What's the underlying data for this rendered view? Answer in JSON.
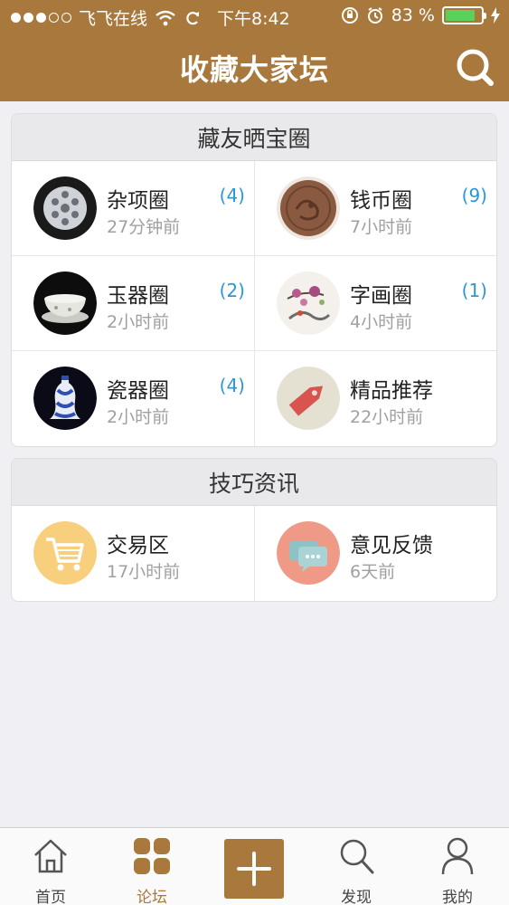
{
  "status_bar": {
    "carrier": "飞飞在线",
    "time": "下午8:42",
    "battery": "83 %",
    "battery_level": 0.83
  },
  "nav": {
    "title": "收藏大家坛"
  },
  "section_share": {
    "title": "藏友晒宝圈",
    "items": [
      {
        "name": "杂项圈",
        "time": "27分钟前",
        "count": "(4)",
        "icon": "misc-ware-icon"
      },
      {
        "name": "钱币圈",
        "time": "7小时前",
        "count": "(9)",
        "icon": "coin-icon"
      },
      {
        "name": "玉器圈",
        "time": "2小时前",
        "count": "(2)",
        "icon": "jade-bowl-icon"
      },
      {
        "name": "字画圈",
        "time": "4小时前",
        "count": "(1)",
        "icon": "painting-icon"
      },
      {
        "name": "瓷器圈",
        "time": "2小时前",
        "count": "(4)",
        "icon": "porcelain-vase-icon"
      },
      {
        "name": "精品推荐",
        "time": "22小时前",
        "count": "",
        "icon": "price-tag-icon"
      }
    ]
  },
  "section_tips": {
    "title": "技巧资讯",
    "items": [
      {
        "name": "交易区",
        "time": "17小时前",
        "icon": "shopping-cart-icon",
        "color": "#f7cf7d"
      },
      {
        "name": "意见反馈",
        "time": "6天前",
        "icon": "chat-bubbles-icon",
        "color": "#ee9a86"
      }
    ]
  },
  "tabbar": {
    "home": "首页",
    "forum": "论坛",
    "discover": "发现",
    "mine": "我的",
    "active": "forum"
  },
  "colors": {
    "brand": "#a8783d",
    "count_blue": "#2a97d9",
    "battery_green": "#5ad15a"
  }
}
